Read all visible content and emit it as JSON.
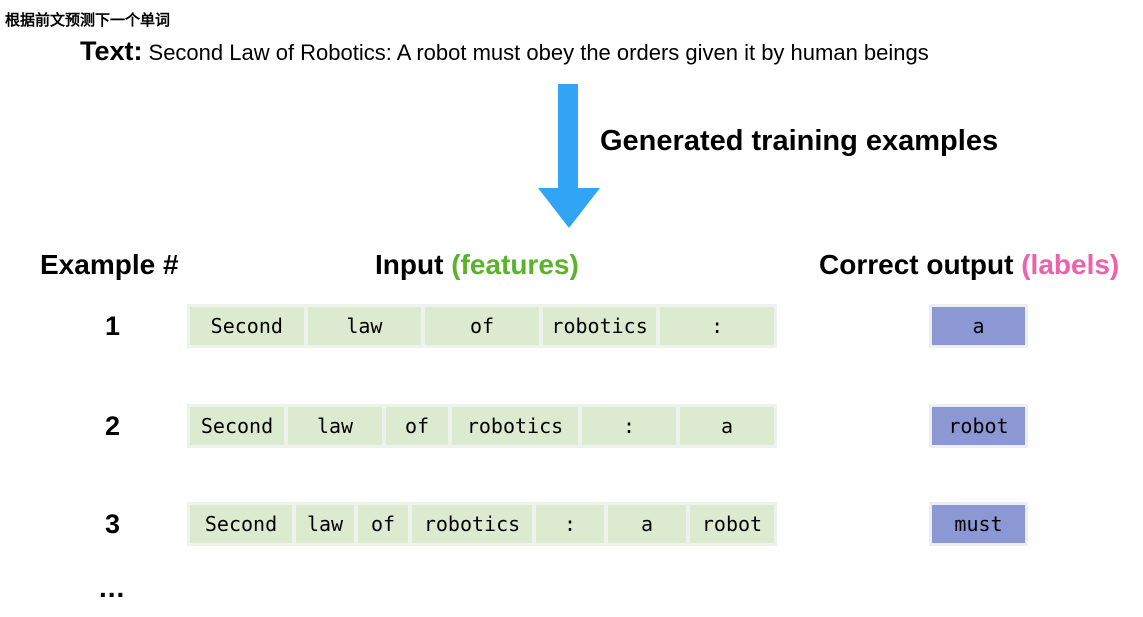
{
  "title": "根据前文预测下一个单词",
  "text_label": "Text:",
  "text_value": "Second Law of Robotics: A robot must obey the orders given it by human beings",
  "arrow_label": "Generated training examples",
  "columns": {
    "example": "Example #",
    "input": "Input",
    "input_note": "(features)",
    "output": "Correct output",
    "output_note": "(labels)"
  },
  "colors": {
    "arrow": "#32a4f5",
    "features": "#5bb32c",
    "labels": "#ee5fac",
    "token_bg": "#dcebcf",
    "label_bg": "#8b98d4"
  },
  "examples": [
    {
      "number": "1",
      "tokens": [
        "Second",
        "law",
        "of",
        "robotics",
        ":"
      ],
      "label": "a"
    },
    {
      "number": "2",
      "tokens": [
        "Second",
        "law",
        "of",
        "robotics",
        ":",
        "a"
      ],
      "label": "robot"
    },
    {
      "number": "3",
      "tokens": [
        "Second",
        "law",
        "of",
        "robotics",
        ":",
        "a",
        "robot"
      ],
      "label": "must"
    }
  ],
  "ellipsis": "..."
}
